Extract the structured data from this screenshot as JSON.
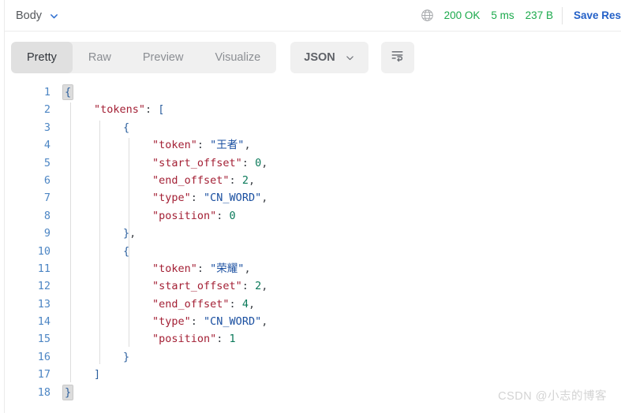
{
  "topbar": {
    "body_label": "Body",
    "chevron_icon": "chevron-down-icon",
    "globe_icon": "globe-icon",
    "status": "200 OK",
    "time": "5 ms",
    "size": "237 B",
    "save_label": "Save Res",
    "colors": {
      "status_green": "#1ba94c",
      "link_blue": "#2360c7"
    }
  },
  "tabs": [
    {
      "label": "Pretty",
      "active": true
    },
    {
      "label": "Raw",
      "active": false
    },
    {
      "label": "Preview",
      "active": false
    },
    {
      "label": "Visualize",
      "active": false
    }
  ],
  "format_button": {
    "label": "JSON",
    "chevron_icon": "chevron-down-icon"
  },
  "wrap_button": {
    "icon": "wrap-lines-icon"
  },
  "editor": {
    "language": "json",
    "total_lines": 18,
    "lines": [
      {
        "num": "1",
        "indent": 0,
        "tokens": [
          {
            "t": "{",
            "c": "br",
            "hl": true
          }
        ]
      },
      {
        "num": "2",
        "indent": 1,
        "tokens": [
          {
            "t": "\"tokens\"",
            "c": "k"
          },
          {
            "t": ": ",
            "c": "p"
          },
          {
            "t": "[",
            "c": "br"
          }
        ]
      },
      {
        "num": "3",
        "indent": 2,
        "tokens": [
          {
            "t": "{",
            "c": "br"
          }
        ]
      },
      {
        "num": "4",
        "indent": 3,
        "tokens": [
          {
            "t": "\"token\"",
            "c": "k"
          },
          {
            "t": ": ",
            "c": "p"
          },
          {
            "t": "\"王者\"",
            "c": "s"
          },
          {
            "t": ",",
            "c": "p"
          }
        ]
      },
      {
        "num": "5",
        "indent": 3,
        "tokens": [
          {
            "t": "\"start_offset\"",
            "c": "k"
          },
          {
            "t": ": ",
            "c": "p"
          },
          {
            "t": "0",
            "c": "n"
          },
          {
            "t": ",",
            "c": "p"
          }
        ]
      },
      {
        "num": "6",
        "indent": 3,
        "tokens": [
          {
            "t": "\"end_offset\"",
            "c": "k"
          },
          {
            "t": ": ",
            "c": "p"
          },
          {
            "t": "2",
            "c": "n"
          },
          {
            "t": ",",
            "c": "p"
          }
        ]
      },
      {
        "num": "7",
        "indent": 3,
        "tokens": [
          {
            "t": "\"type\"",
            "c": "k"
          },
          {
            "t": ": ",
            "c": "p"
          },
          {
            "t": "\"CN_WORD\"",
            "c": "s"
          },
          {
            "t": ",",
            "c": "p"
          }
        ]
      },
      {
        "num": "8",
        "indent": 3,
        "tokens": [
          {
            "t": "\"position\"",
            "c": "k"
          },
          {
            "t": ": ",
            "c": "p"
          },
          {
            "t": "0",
            "c": "n"
          }
        ]
      },
      {
        "num": "9",
        "indent": 2,
        "tokens": [
          {
            "t": "}",
            "c": "br"
          },
          {
            "t": ",",
            "c": "p"
          }
        ]
      },
      {
        "num": "10",
        "indent": 2,
        "tokens": [
          {
            "t": "{",
            "c": "br"
          }
        ]
      },
      {
        "num": "11",
        "indent": 3,
        "tokens": [
          {
            "t": "\"token\"",
            "c": "k"
          },
          {
            "t": ": ",
            "c": "p"
          },
          {
            "t": "\"荣耀\"",
            "c": "s"
          },
          {
            "t": ",",
            "c": "p"
          }
        ]
      },
      {
        "num": "12",
        "indent": 3,
        "tokens": [
          {
            "t": "\"start_offset\"",
            "c": "k"
          },
          {
            "t": ": ",
            "c": "p"
          },
          {
            "t": "2",
            "c": "n"
          },
          {
            "t": ",",
            "c": "p"
          }
        ]
      },
      {
        "num": "13",
        "indent": 3,
        "tokens": [
          {
            "t": "\"end_offset\"",
            "c": "k"
          },
          {
            "t": ": ",
            "c": "p"
          },
          {
            "t": "4",
            "c": "n"
          },
          {
            "t": ",",
            "c": "p"
          }
        ]
      },
      {
        "num": "14",
        "indent": 3,
        "tokens": [
          {
            "t": "\"type\"",
            "c": "k"
          },
          {
            "t": ": ",
            "c": "p"
          },
          {
            "t": "\"CN_WORD\"",
            "c": "s"
          },
          {
            "t": ",",
            "c": "p"
          }
        ]
      },
      {
        "num": "15",
        "indent": 3,
        "tokens": [
          {
            "t": "\"position\"",
            "c": "k"
          },
          {
            "t": ": ",
            "c": "p"
          },
          {
            "t": "1",
            "c": "n"
          }
        ]
      },
      {
        "num": "16",
        "indent": 2,
        "tokens": [
          {
            "t": "}",
            "c": "br"
          }
        ]
      },
      {
        "num": "17",
        "indent": 1,
        "tokens": [
          {
            "t": "]",
            "c": "br"
          }
        ]
      },
      {
        "num": "18",
        "indent": 0,
        "tokens": [
          {
            "t": "}",
            "c": "br",
            "hl": true
          }
        ]
      }
    ],
    "colors": {
      "key": "#a31f34",
      "string": "#1a4fa0",
      "number": "#0b7a5a",
      "bracket": "#2b5f9e",
      "line_number": "#4d86c4",
      "indent_guide": "#dddddd"
    }
  },
  "watermark": {
    "text": "CSDN @小志的博客"
  }
}
